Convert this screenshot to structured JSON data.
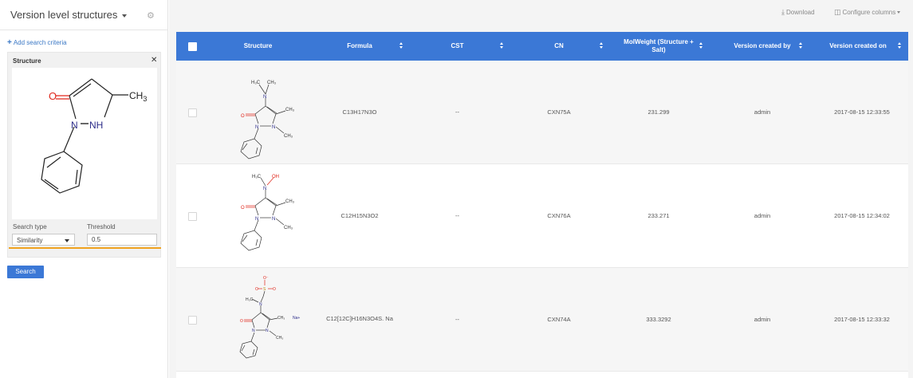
{
  "sidebar": {
    "title": "Version level structures",
    "add_criteria": "Add search criteria",
    "criteria": {
      "title": "Structure",
      "search_type_label": "Search type",
      "threshold_label": "Threshold",
      "search_type_value": "Similarity",
      "threshold_value": "0.5"
    },
    "search_button": "Search"
  },
  "toolbar": {
    "download": "Download",
    "configure": "Configure columns"
  },
  "table": {
    "headers": {
      "structure": "Structure",
      "formula": "Formula",
      "cst": "CST",
      "cn": "CN",
      "molweight": "MolWeight (Structure + Salt)",
      "created_by": "Version created by",
      "created_on": "Version created on"
    },
    "rows": [
      {
        "formula": "C13H17N3O",
        "cst": "--",
        "cn": "CXN75A",
        "molweight": "231.299",
        "created_by": "admin",
        "created_on": "2017-08-15 12:33:55"
      },
      {
        "formula": "C12H15N3O2",
        "cst": "--",
        "cn": "CXN76A",
        "molweight": "233.271",
        "created_by": "admin",
        "created_on": "2017-08-15 12:34:02"
      },
      {
        "formula": "C12[12C]H16N3O4S. Na",
        "cst": "--",
        "cn": "CXN74A",
        "molweight": "333.3292",
        "created_by": "admin",
        "created_on": "2017-08-15 12:33:32",
        "salt_label": "Na+"
      }
    ]
  },
  "chem": {
    "query": {
      "O": "O",
      "CH3": "CH",
      "N1": "N",
      "NH": "NH"
    },
    "r1": {
      "NMe2a": "H₃C",
      "NMe2b": "CH₃",
      "N": "N",
      "O": "O",
      "N1": "N",
      "N2": "N",
      "Me4": "CH₃",
      "MeN": "CH₃"
    },
    "r2": {
      "HMe": "H₃C",
      "OH": "OH",
      "N": "N",
      "O": "O",
      "N1": "N",
      "N2": "N",
      "Me4": "CH₃",
      "MeN": "CH₃"
    },
    "r3": {
      "Om": "O⁻",
      "S": "S",
      "O1": "O",
      "O2": "O",
      "HC": "H₃C",
      "N": "N",
      "O": "O",
      "N1": "N",
      "N2": "N",
      "Me4": "CH₃",
      "MeN": "CH₃"
    }
  },
  "colors": {
    "accent": "#3b78d6",
    "focus": "#f0a21f",
    "oxygen": "#e0261b",
    "nitrogen": "#2e2e8a"
  }
}
